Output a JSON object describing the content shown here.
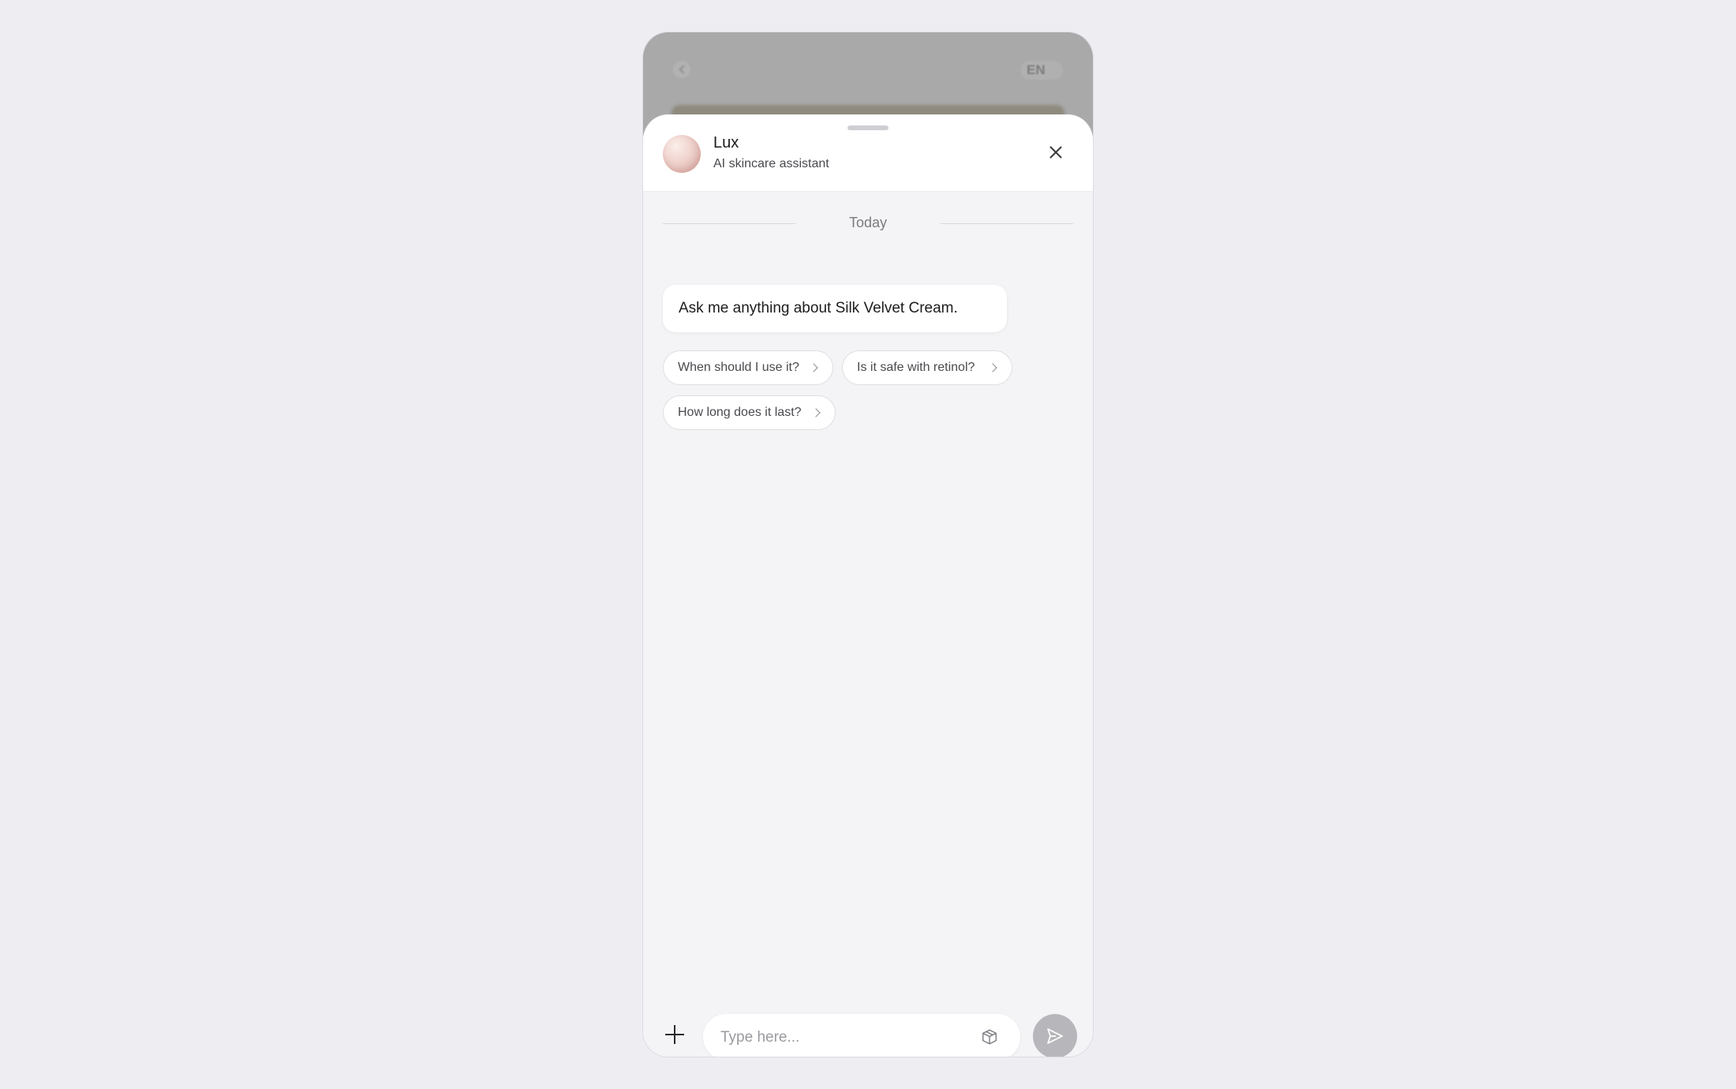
{
  "backdrop": {
    "language_label": "EN"
  },
  "assistant": {
    "name": "Lux",
    "subtitle": "AI skincare assistant"
  },
  "chat": {
    "date_separator": "Today",
    "messages": [
      {
        "from": "assistant",
        "text": "Ask me anything about Silk Velvet Cream."
      }
    ],
    "suggestions": [
      "When should I use it?",
      "Is it safe with retinol?",
      "How long does it last?"
    ]
  },
  "composer": {
    "placeholder": "Type here...",
    "value": ""
  },
  "icons": {
    "close": "close-icon",
    "add": "plus-icon",
    "product": "box-icon",
    "send": "send-icon"
  },
  "colors": {
    "page_background": "#eeedf2",
    "sheet_background": "#f4f4f6",
    "send_button": "#b7b7bb",
    "avatar_tint": "#efd2cc"
  }
}
